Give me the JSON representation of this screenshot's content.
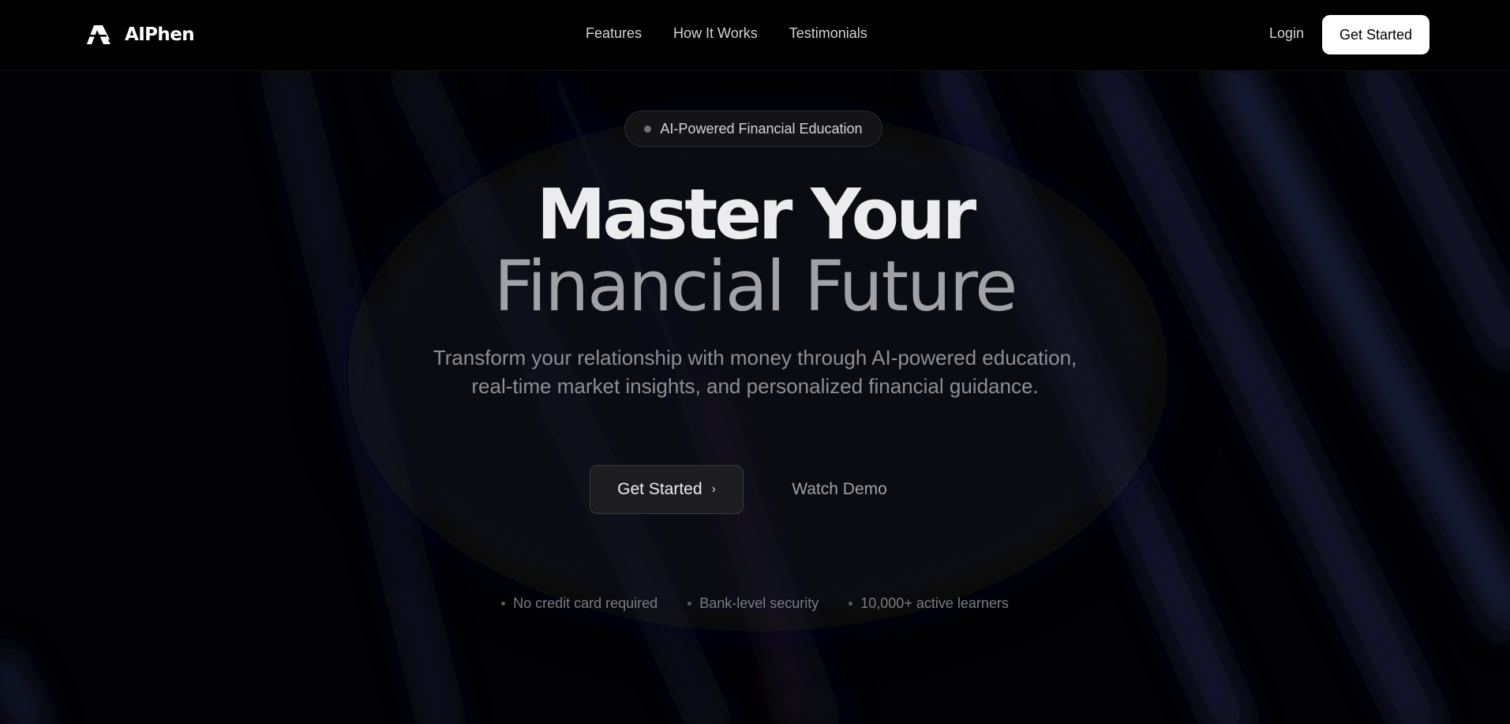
{
  "brand": {
    "name": "AIPhen",
    "logo_icon": "triangle-logo-icon"
  },
  "nav": {
    "links": [
      {
        "label": "Features"
      },
      {
        "label": "How It Works"
      },
      {
        "label": "Testimonials"
      }
    ],
    "login_label": "Login",
    "cta_label": "Get Started"
  },
  "hero": {
    "badge": "AI-Powered Financial Education",
    "title_line1": "Master Your",
    "title_line2": "Financial Future",
    "subtitle_line1": "Transform your relationship with money through AI-powered education,",
    "subtitle_line2": "real-time market insights, and personalized financial guidance.",
    "primary_cta": "Get Started",
    "primary_cta_icon": "chevron-right-icon",
    "secondary_cta": "Watch Demo"
  },
  "perks": [
    {
      "label": "No credit card required"
    },
    {
      "label": "Bank-level security"
    },
    {
      "label": "10,000+ active learners"
    }
  ],
  "colors": {
    "background": "#000000",
    "streaks": "#1e2348",
    "cta_primary_bg": "#1d1d20",
    "top_cta_bg": "#ffffff",
    "title_primary": "#ececee",
    "title_secondary": "#a1a1a6"
  }
}
